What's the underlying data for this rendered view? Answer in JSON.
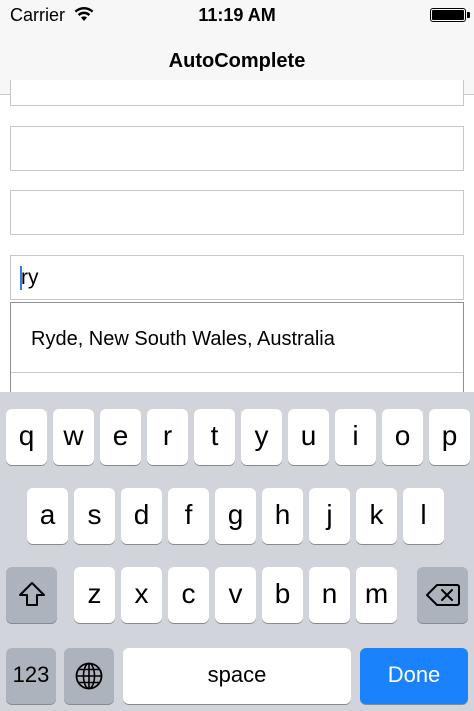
{
  "status_bar": {
    "carrier": "Carrier",
    "time": "11:19 AM",
    "wifi_icon": "wifi-icon",
    "battery_icon": "battery-icon"
  },
  "nav": {
    "title": "AutoComplete"
  },
  "form": {
    "active_value": "ry"
  },
  "suggestions": [
    {
      "label": "Ryde, New South Wales, Australia"
    }
  ],
  "keyboard": {
    "row1": [
      "q",
      "w",
      "e",
      "r",
      "t",
      "y",
      "u",
      "i",
      "o",
      "p"
    ],
    "row2": [
      "a",
      "s",
      "d",
      "f",
      "g",
      "h",
      "j",
      "k",
      "l"
    ],
    "row3": [
      "z",
      "x",
      "c",
      "v",
      "b",
      "n",
      "m"
    ],
    "numbers_label": "123",
    "space_label": "space",
    "done_label": "Done",
    "shift_icon": "shift-icon",
    "delete_icon": "delete-icon",
    "globe_icon": "globe-icon",
    "accent_color": "#1a82fb"
  }
}
